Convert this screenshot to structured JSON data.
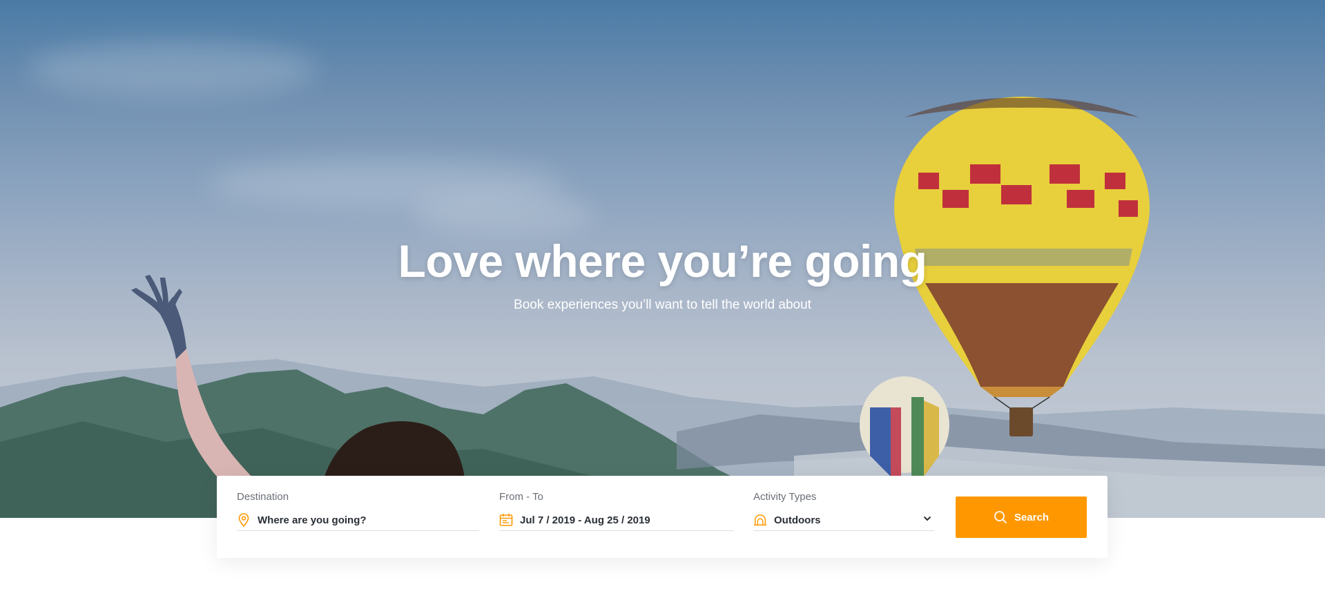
{
  "hero": {
    "title": "Love where you’re going",
    "subtitle": "Book experiences you’ll want to tell the world about"
  },
  "search": {
    "destination": {
      "label": "Destination",
      "value": "Where are you going?",
      "icon": "map-pin-icon"
    },
    "dates": {
      "label": "From - To",
      "value": "Jul 7 / 2019 - Aug 25 / 2019",
      "icon": "calendar-icon"
    },
    "activity": {
      "label": "Activity Types",
      "value": "Outdoors",
      "icon": "tent-icon"
    },
    "button_label": "Search"
  },
  "colors": {
    "accent": "#ff9800",
    "text": "#2a2f35",
    "label": "#6a6f76"
  }
}
